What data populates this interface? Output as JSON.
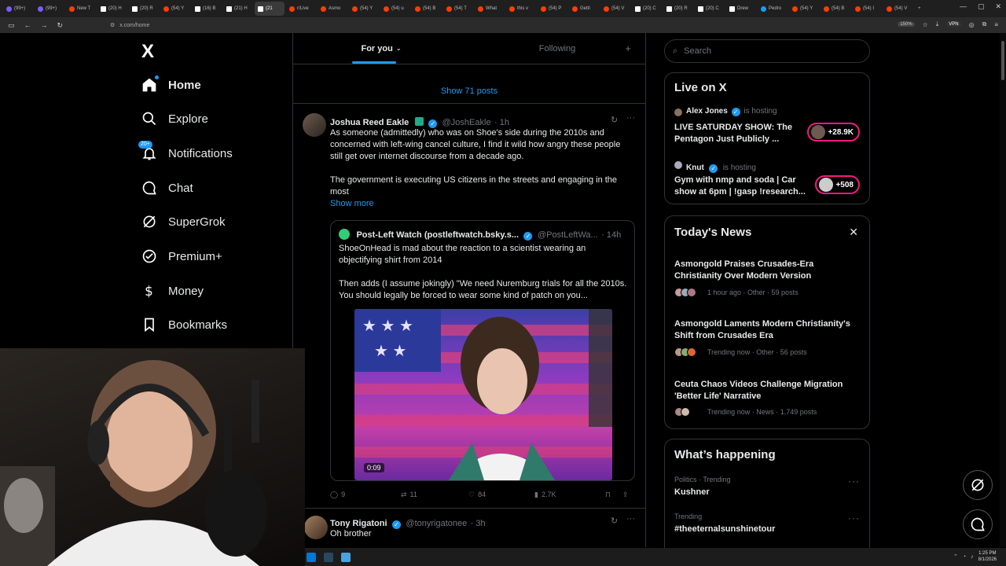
{
  "browser": {
    "tabs": [
      {
        "label": "(99+)",
        "fav": "purple"
      },
      {
        "label": "(99+)",
        "fav": "purple"
      },
      {
        "label": "New T",
        "fav": "red"
      },
      {
        "label": "(20) H",
        "fav": "x"
      },
      {
        "label": "(20) R",
        "fav": "x"
      },
      {
        "label": "(54) Y",
        "fav": "red"
      },
      {
        "label": "(16) B",
        "fav": "x"
      },
      {
        "label": "(21) H",
        "fav": "x"
      },
      {
        "label": "(21",
        "fav": "x",
        "active": true
      },
      {
        "label": "r/Live",
        "fav": "red"
      },
      {
        "label": "Asmo",
        "fav": "red"
      },
      {
        "label": "(54) Y",
        "fav": "red"
      },
      {
        "label": "(54) u",
        "fav": "red"
      },
      {
        "label": "(54) B",
        "fav": "red"
      },
      {
        "label": "(54) T",
        "fav": "red"
      },
      {
        "label": "What",
        "fav": "red"
      },
      {
        "label": "this v",
        "fav": "red"
      },
      {
        "label": "(54) P",
        "fav": "red"
      },
      {
        "label": "Getti",
        "fav": "red"
      },
      {
        "label": "(54) V",
        "fav": "red"
      },
      {
        "label": "(20) C",
        "fav": "x"
      },
      {
        "label": "(20) R",
        "fav": "x"
      },
      {
        "label": "(20) C",
        "fav": "x"
      },
      {
        "label": "Drew",
        "fav": "x"
      },
      {
        "label": "Pedro",
        "fav": "blue"
      },
      {
        "label": "(54) Y",
        "fav": "red"
      },
      {
        "label": "(54) B",
        "fav": "red"
      },
      {
        "label": "(54) I",
        "fav": "red"
      },
      {
        "label": "(54) V",
        "fav": "red"
      }
    ],
    "url": "x.com/home",
    "zoom": "150%",
    "vpn": "VPN"
  },
  "nav": {
    "logo": "X",
    "items": [
      {
        "label": "Home",
        "icon": "home-icon"
      },
      {
        "label": "Explore",
        "icon": "search-icon"
      },
      {
        "label": "Notifications",
        "icon": "bell-icon",
        "badge": "20+"
      },
      {
        "label": "Chat",
        "icon": "chat-icon"
      },
      {
        "label": "SuperGrok",
        "icon": "grok-icon"
      },
      {
        "label": "Premium+",
        "icon": "premium-icon"
      },
      {
        "label": "Money",
        "icon": "money-icon"
      },
      {
        "label": "Bookmarks",
        "icon": "bookmark-icon"
      }
    ]
  },
  "feed": {
    "tabs": [
      "For you",
      "Following"
    ],
    "show_posts": "Show 71 posts",
    "post1": {
      "name": "Joshua Reed Eakle",
      "handle": "@JoshEakle",
      "time": "· 1h",
      "text1": "As someone (admittedly) who was on Shoe's side during the 2010s and concerned with left-wing cancel culture, I find it wild how angry these people still get over internet discourse from a decade ago.",
      "text2": "The government is executing US citizens in the streets and engaging in the most",
      "show_more": "Show more",
      "quote": {
        "name": "Post-Left Watch (postleftwatch.bsky.s...",
        "handle": "@PostLeftWa...",
        "time": "· 14h",
        "text1": "ShoeOnHead is mad about the reaction to a scientist wearing an objectifying shirt from 2014",
        "text2": "Then adds (I assume jokingly) \"We need Nuremburg trials for all the 2010s. You should legally be forced to wear some kind of patch on you...",
        "video_time": "0:09"
      },
      "replies": "9",
      "reposts": "11",
      "likes": "84",
      "views": "2.7K"
    },
    "post2": {
      "name": "Tony Rigatoni",
      "handle": "@tonyrigatonee",
      "time": "· 3h",
      "text": "Oh brother"
    }
  },
  "right": {
    "search_placeholder": "Search",
    "live": {
      "title": "Live on X",
      "items": [
        {
          "host": "Alex Jones",
          "status": "is hosting",
          "title": "LIVE SATURDAY SHOW: The Pentagon Just Publicly ...",
          "count": "+28.9K"
        },
        {
          "host": "Knut",
          "status": "is hosting",
          "title": "Gym with nmp and soda | Car show at 6pm | !gasp !research...",
          "count": "+508"
        }
      ]
    },
    "news": {
      "title": "Today's News",
      "items": [
        {
          "title": "Asmongold Praises Crusades-Era Christianity Over Modern Version",
          "meta": "1 hour ago · Other · 59 posts"
        },
        {
          "title": "Asmongold Laments Modern Christianity's Shift from Crusades Era",
          "meta": "Trending now · Other · 56 posts"
        },
        {
          "title": "Ceuta Chaos Videos Challenge Migration 'Better Life' Narrative",
          "meta": "Trending now · News · 1,749 posts"
        }
      ]
    },
    "happening": {
      "title": "What’s happening",
      "items": [
        {
          "context": "Politics · Trending",
          "topic": "Kushner"
        },
        {
          "context": "Trending",
          "topic": "#theeternalsunshinetour"
        }
      ]
    }
  },
  "taskbar": {
    "time": "1:25 PM",
    "date": "8/1/2026"
  },
  "colors": {
    "accent": "#1d9bf0",
    "live_pill": "#f91880"
  }
}
